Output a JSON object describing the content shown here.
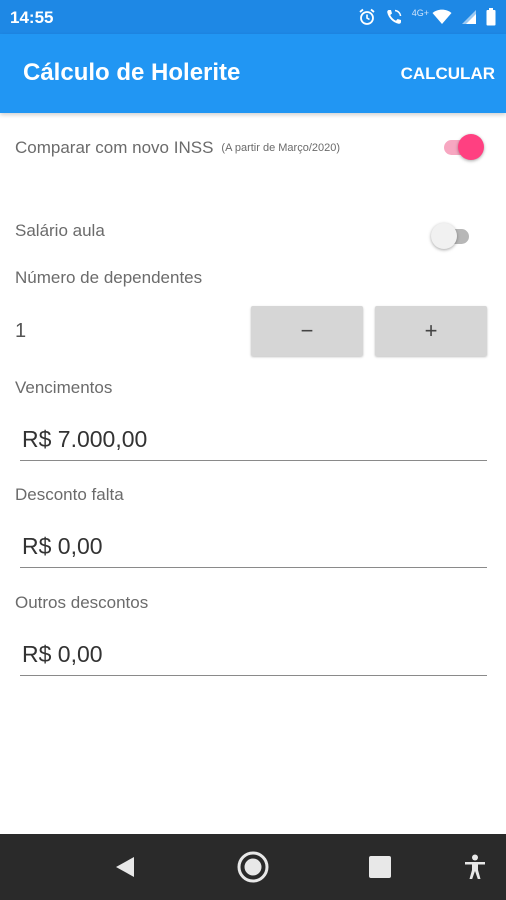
{
  "status_bar": {
    "time": "14:55",
    "network_label": "4G+",
    "icons": [
      "alarm-icon",
      "wifi-call-icon",
      "wifi-icon",
      "signal-icon",
      "battery-icon"
    ]
  },
  "app_bar": {
    "title": "Cálculo de Holerite",
    "action_label": "CALCULAR"
  },
  "form": {
    "compare_inss": {
      "label": "Comparar com novo INSS",
      "note": "(A partir de Março/2020)",
      "checked": true
    },
    "salario_aula": {
      "label": "Salário aula",
      "checked": false
    },
    "dependentes": {
      "label": "Número de dependentes",
      "value": "1",
      "minus_label": "−",
      "plus_label": "+"
    },
    "vencimentos": {
      "label": "Vencimentos",
      "value": "R$ 7.000,00"
    },
    "desconto_falta": {
      "label": "Desconto falta",
      "value": "R$ 0,00"
    },
    "outros_descontos": {
      "label": "Outros descontos",
      "value": "R$ 0,00"
    }
  },
  "nav_bar": {
    "items": [
      "back-icon",
      "home-icon",
      "recents-icon",
      "accessibility-icon"
    ]
  },
  "colors": {
    "primary": "#2196f3",
    "primary_dark": "#1e88e5",
    "accent": "#ff4081",
    "nav_background": "#2a2a2a"
  }
}
